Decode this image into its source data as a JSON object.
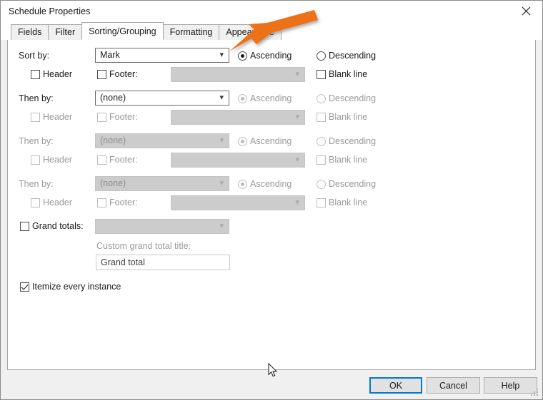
{
  "window": {
    "title": "Schedule Properties",
    "close_icon": "close-icon"
  },
  "tabs": [
    {
      "label": "Fields",
      "active": false
    },
    {
      "label": "Filter",
      "active": false
    },
    {
      "label": "Sorting/Grouping",
      "active": true
    },
    {
      "label": "Formatting",
      "active": false
    },
    {
      "label": "Appearance",
      "active": false
    }
  ],
  "sort_rows": [
    {
      "label": "Sort by:",
      "label_disabled": false,
      "field_value": "Mark",
      "field_disabled": false,
      "ascending_label": "Ascending",
      "ascending_selected": true,
      "descending_label": "Descending",
      "descending_selected": false,
      "radios_disabled": false,
      "header_label": "Header",
      "header_checked": false,
      "header_disabled": false,
      "footer_label": "Footer:",
      "footer_checked": false,
      "footer_disabled": false,
      "footer_combo_value": "",
      "blank_line_label": "Blank line",
      "blank_line_checked": false,
      "blank_line_disabled": false
    },
    {
      "label": "Then by:",
      "label_disabled": false,
      "field_value": "(none)",
      "field_disabled": false,
      "ascending_label": "Ascending",
      "ascending_selected": true,
      "descending_label": "Descending",
      "descending_selected": false,
      "radios_disabled": true,
      "header_label": "Header",
      "header_checked": false,
      "header_disabled": true,
      "footer_label": "Footer:",
      "footer_checked": false,
      "footer_disabled": true,
      "footer_combo_value": "",
      "blank_line_label": "Blank line",
      "blank_line_checked": false,
      "blank_line_disabled": true
    },
    {
      "label": "Then by:",
      "label_disabled": true,
      "field_value": "(none)",
      "field_disabled": true,
      "ascending_label": "Ascending",
      "ascending_selected": true,
      "descending_label": "Descending",
      "descending_selected": false,
      "radios_disabled": true,
      "header_label": "Header",
      "header_checked": false,
      "header_disabled": true,
      "footer_label": "Footer:",
      "footer_checked": false,
      "footer_disabled": true,
      "footer_combo_value": "",
      "blank_line_label": "Blank line",
      "blank_line_checked": false,
      "blank_line_disabled": true
    },
    {
      "label": "Then by:",
      "label_disabled": true,
      "field_value": "(none)",
      "field_disabled": true,
      "ascending_label": "Ascending",
      "ascending_selected": true,
      "descending_label": "Descending",
      "descending_selected": false,
      "radios_disabled": true,
      "header_label": "Header",
      "header_checked": false,
      "header_disabled": true,
      "footer_label": "Footer:",
      "footer_checked": false,
      "footer_disabled": true,
      "footer_combo_value": "",
      "blank_line_label": "Blank line",
      "blank_line_checked": false,
      "blank_line_disabled": true
    }
  ],
  "grand_totals": {
    "label": "Grand totals:",
    "checked": false,
    "combo_value": "",
    "combo_disabled": true,
    "custom_title_label": "Custom grand total title:",
    "custom_title_value": "Grand total"
  },
  "itemize": {
    "label": "Itemize every instance",
    "checked": true
  },
  "buttons": {
    "ok": "OK",
    "cancel": "Cancel",
    "help": "Help"
  },
  "annotation": {
    "arrow_color": "#ED7117",
    "arrow_target": "ascending-radio-row-1"
  }
}
